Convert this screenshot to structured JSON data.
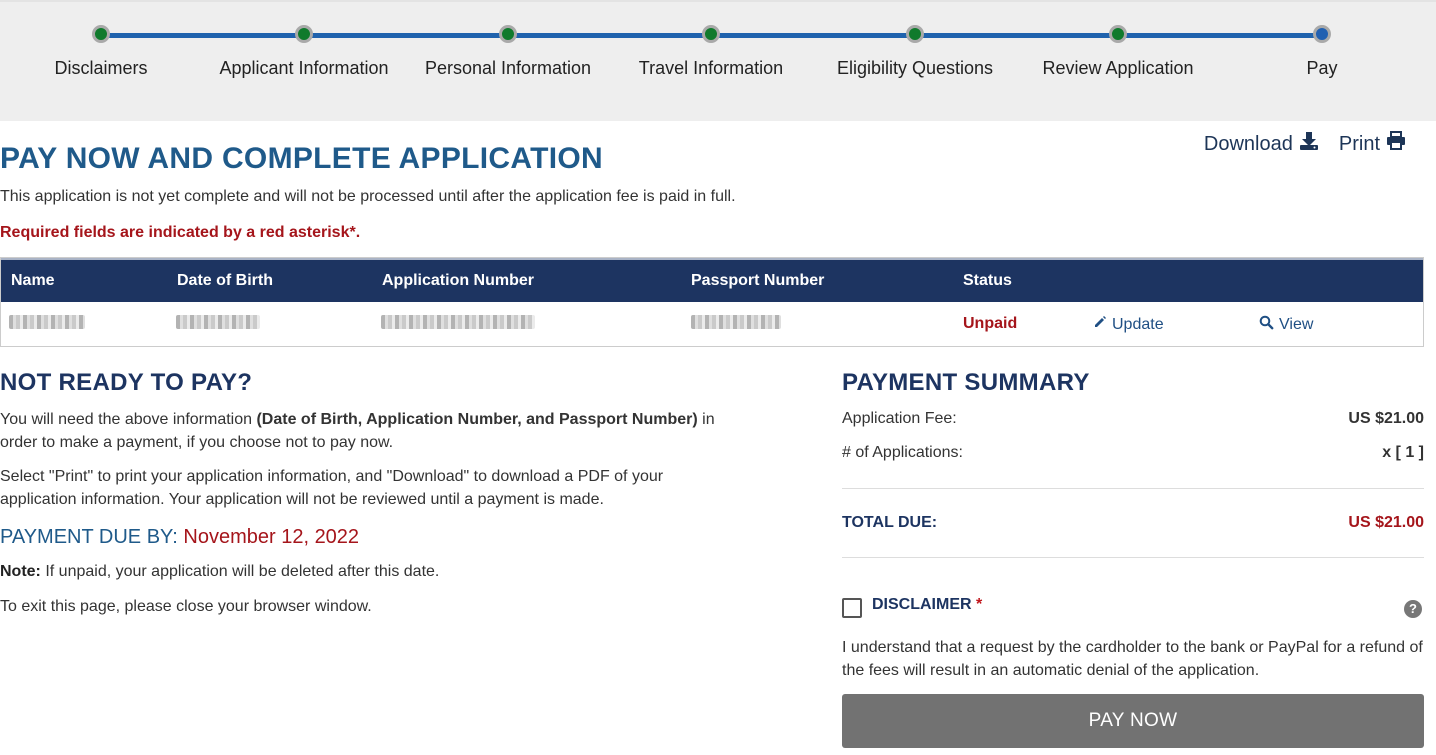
{
  "stepper": {
    "steps": [
      {
        "label": "Disclaimers",
        "state": "complete"
      },
      {
        "label": "Applicant Information",
        "state": "complete"
      },
      {
        "label": "Personal Information",
        "state": "complete"
      },
      {
        "label": "Travel Information",
        "state": "complete"
      },
      {
        "label": "Eligibility Questions",
        "state": "complete"
      },
      {
        "label": "Review Application",
        "state": "complete"
      },
      {
        "label": "Pay",
        "state": "current"
      }
    ],
    "complete_color": "#0f7a2c",
    "current_color": "#2160b1"
  },
  "header": {
    "title": "PAY NOW AND COMPLETE APPLICATION",
    "download_label": "Download",
    "download_icon": "download-icon",
    "print_label": "Print",
    "print_icon": "print-icon",
    "intro": "This application is not yet complete and will not be processed until after the application fee is paid in full.",
    "required_note": "Required fields are indicated by a red asterisk*."
  },
  "table": {
    "columns": [
      "Name",
      "Date of Birth",
      "Application Number",
      "Passport Number",
      "Status"
    ],
    "rows": [
      {
        "name": "",
        "dob": "",
        "application_number": "",
        "passport_number": "",
        "status": "Unpaid",
        "update_label": "Update",
        "view_label": "View"
      }
    ]
  },
  "not_ready": {
    "heading": "NOT READY TO PAY?",
    "p1_start": "You will need the above information ",
    "p1_bold": "(Date of Birth, Application Number, and Passport Number)",
    "p1_end": " in order to make a payment, if you choose not to pay now.",
    "p2": "Select \"Print\" to print your application information, and \"Download\" to download a PDF of your application information. Your application will not be reviewed until a payment is made.",
    "due_label": "PAYMENT DUE BY:",
    "due_date": "November 12, 2022",
    "note_label": "Note:",
    "note_text": " If unpaid, your application will be deleted after this date.",
    "exit_text": "To exit this page, please close your browser window."
  },
  "summary": {
    "heading": "PAYMENT SUMMARY",
    "fee_label": "Application Fee:",
    "fee_value": "US $21.00",
    "count_label": "# of Applications:",
    "count_value": "x [ 1 ]",
    "total_label": "TOTAL DUE:",
    "total_value": "US $21.00",
    "disclaimer_label": "DISCLAIMER",
    "disclaimer_asterisk": "*",
    "disclaimer_checked": false,
    "disclaimer_text": "I understand that a request by the cardholder to the bank or PayPal for a refund of the fees will result in an automatic denial of the application.",
    "help_icon": "question-circle-icon",
    "pay_button": "PAY NOW"
  }
}
